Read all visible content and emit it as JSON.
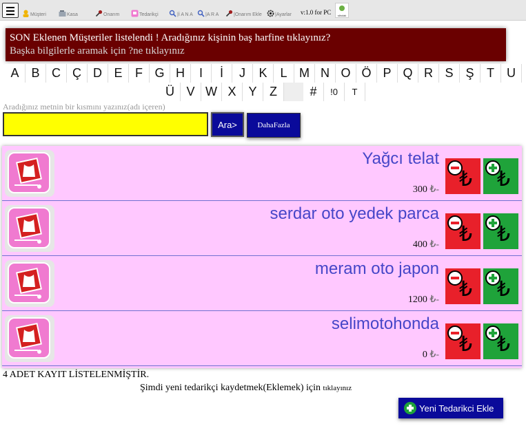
{
  "toolbar": {
    "menu_icon": "hamburger-menu-icon",
    "items": [
      {
        "label": "Müşteri",
        "icon": "person-icon",
        "color": "#f0b400"
      },
      {
        "label": "Kasa",
        "icon": "cash-register-icon",
        "color": "#8a8a8a"
      },
      {
        "label": "Onarım",
        "icon": "wrench-icon",
        "color": "#a02020"
      },
      {
        "label": "Tedarikçi",
        "icon": "supplier-icon",
        "color": "#e060c0"
      },
      {
        "label": "|İ A N A",
        "icon": "search-icon",
        "color": "#4060c0"
      },
      {
        "label": "|A R A",
        "icon": "search-icon",
        "color": "#4060c0"
      },
      {
        "label": "|Onarım Ekle",
        "icon": "wrench-icon",
        "color": "#a02020"
      },
      {
        "label": "|Ayarlar",
        "icon": "gear-icon",
        "color": "#333333"
      }
    ],
    "version": "v:1.0 for PC",
    "logo_text": "sibulak"
  },
  "notice": {
    "line1": "SON Eklenen Müşteriler listelendi ! Aradığınız kişinin baş harfine tıklayınız?",
    "line2": "Başka bilgilerle aramak için ?ne tıklayınız"
  },
  "alphabet": {
    "row1": [
      "A",
      "B",
      "C",
      "Ç",
      "D",
      "E",
      "F",
      "G",
      "H",
      "I",
      "İ",
      "J",
      "K",
      "L",
      "M",
      "N",
      "O",
      "Ö",
      "P",
      "Q",
      "R",
      "S",
      "Ş",
      "T",
      "U"
    ],
    "row2": [
      "Ü",
      "V",
      "W",
      "X",
      "Y",
      "Z",
      "",
      "#",
      "!0",
      "T"
    ]
  },
  "search": {
    "hint": "Aradığınız metnin bir kısmını yazınız(adı içeren)",
    "value": "",
    "ara_label": "Ara>",
    "daha_label": "DahaFazla"
  },
  "records": [
    {
      "name": "Yağcı telat",
      "amount": "300",
      "currency": "₺-"
    },
    {
      "name": "serdar oto yedek parca",
      "amount": "400",
      "currency": "₺-"
    },
    {
      "name": "meram oto japon",
      "amount": "1200",
      "currency": "₺-"
    },
    {
      "name": "selimotohonda",
      "amount": "0",
      "currency": "₺-"
    }
  ],
  "lira_symbol": "₺",
  "footer": {
    "count_text": "4 ADET KAYIT LİSTELENMİŞTİR.",
    "add_hint": "Şimdi yeni tedarikçi kaydetmek(Eklemek) için",
    "add_hint_small": "tıklayınız",
    "add_button": "Yeni Tedarikci Ekle"
  },
  "colors": {
    "notice_bg": "#6a0000",
    "list_bg": "#ffc8ff",
    "name_color": "#4646c8",
    "button_blue": "#0a0a9a",
    "minus_red": "#e8202a",
    "plus_green": "#1fa33a",
    "search_yellow": "#ffff00"
  }
}
